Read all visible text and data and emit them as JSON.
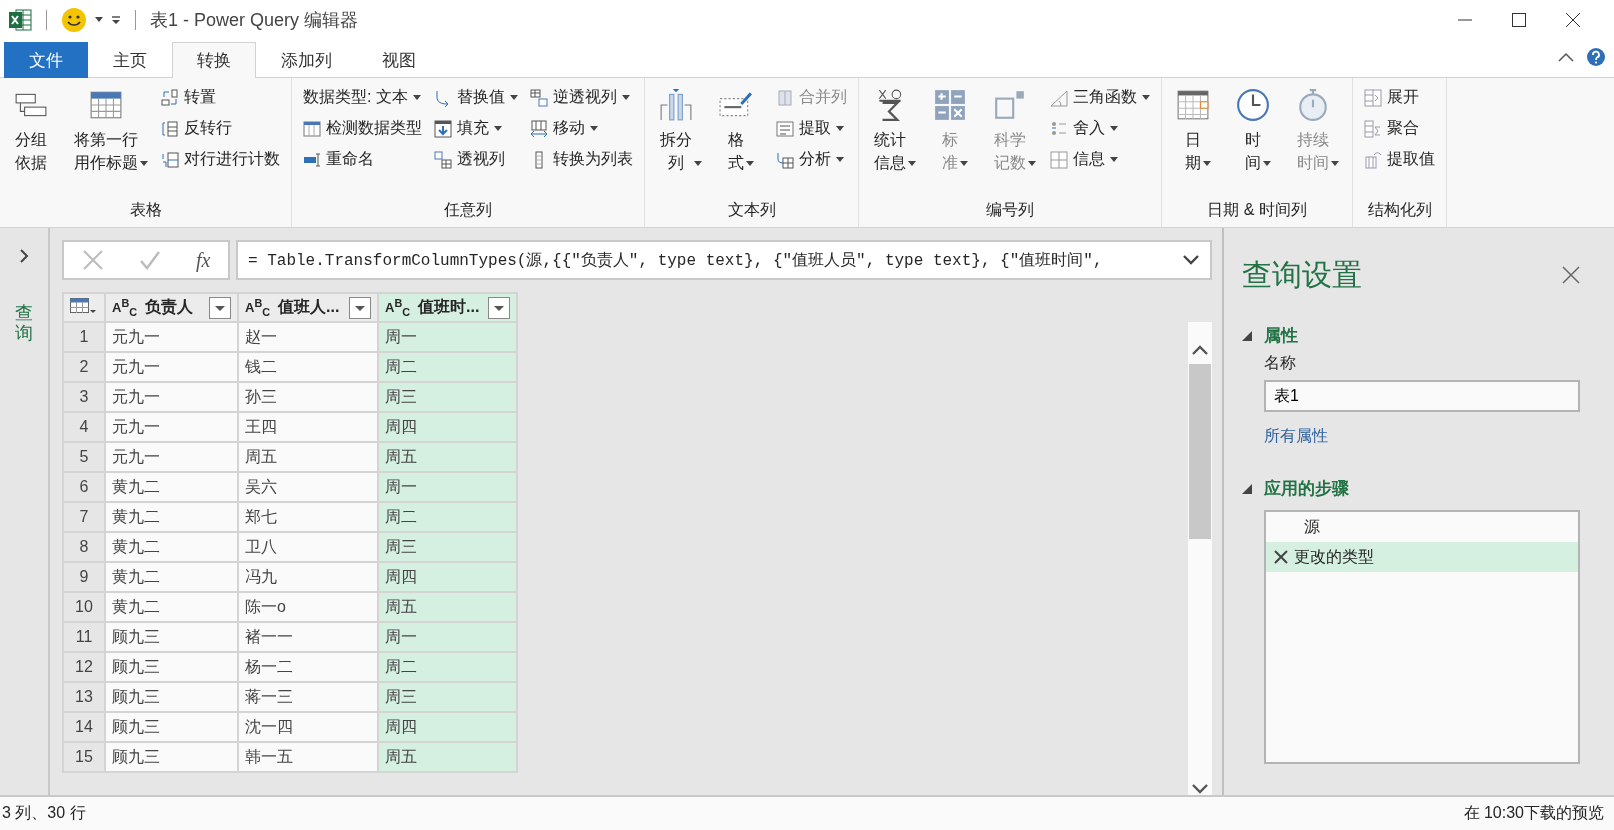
{
  "window": {
    "title": "表1 - Power Query 编辑器"
  },
  "tabs": [
    {
      "label": "文件",
      "kind": "file",
      "selected": false
    },
    {
      "label": "主页",
      "kind": "tab",
      "selected": false
    },
    {
      "label": "转换",
      "kind": "tab",
      "selected": true
    },
    {
      "label": "添加列",
      "kind": "tab",
      "selected": false
    },
    {
      "label": "视图",
      "kind": "tab",
      "selected": false
    }
  ],
  "ribbon": {
    "groups": [
      {
        "label": "表格",
        "columns": [
          {
            "kind": "large",
            "label": "分组依据",
            "dropdown": false,
            "disabled": false
          },
          {
            "kind": "large",
            "label": "将第一行用作标题",
            "dropdown": true,
            "disabled": false
          },
          {
            "kind": "stack",
            "items": [
              {
                "label": "转置",
                "dropdown": false,
                "disabled": false
              },
              {
                "label": "反转行",
                "dropdown": false,
                "disabled": false
              },
              {
                "label": "对行进行计数",
                "dropdown": false,
                "disabled": false
              }
            ]
          }
        ]
      },
      {
        "label": "任意列",
        "columns": [
          {
            "kind": "stack",
            "items": [
              {
                "label": "数据类型: 文本",
                "dropdown": true,
                "disabled": false
              },
              {
                "label": "检测数据类型",
                "dropdown": false,
                "disabled": false
              },
              {
                "label": "重命名",
                "dropdown": false,
                "disabled": false
              }
            ]
          },
          {
            "kind": "stack",
            "items": [
              {
                "label": "替换值",
                "dropdown": true,
                "disabled": false
              },
              {
                "label": "填充",
                "dropdown": true,
                "disabled": false
              },
              {
                "label": "透视列",
                "dropdown": false,
                "disabled": false
              }
            ]
          },
          {
            "kind": "stack",
            "items": [
              {
                "label": "逆透视列",
                "dropdown": true,
                "disabled": false
              },
              {
                "label": "移动",
                "dropdown": true,
                "disabled": false
              },
              {
                "label": "转换为列表",
                "dropdown": false,
                "disabled": false
              }
            ]
          }
        ]
      },
      {
        "label": "文本列",
        "columns": [
          {
            "kind": "large",
            "label": "拆分列",
            "dropdown": true,
            "disabled": false
          },
          {
            "kind": "large",
            "label": "格式",
            "dropdown": true,
            "disabled": false
          },
          {
            "kind": "stack",
            "items": [
              {
                "label": "合并列",
                "dropdown": false,
                "disabled": true
              },
              {
                "label": "提取",
                "dropdown": true,
                "disabled": false
              },
              {
                "label": "分析",
                "dropdown": true,
                "disabled": false
              }
            ]
          }
        ]
      },
      {
        "label": "编号列",
        "columns": [
          {
            "kind": "large",
            "label": "统计信息",
            "dropdown": true,
            "disabled": false
          },
          {
            "kind": "large",
            "label": "标准",
            "dropdown": true,
            "disabled": true
          },
          {
            "kind": "large",
            "label": "科学记数",
            "dropdown": true,
            "disabled": true
          },
          {
            "kind": "stack",
            "items": [
              {
                "label": "三角函数",
                "dropdown": true,
                "disabled": false
              },
              {
                "label": "舍入",
                "dropdown": true,
                "disabled": false
              },
              {
                "label": "信息",
                "dropdown": true,
                "disabled": false
              }
            ]
          }
        ]
      },
      {
        "label": "日期 & 时间列",
        "columns": [
          {
            "kind": "large",
            "label": "日期",
            "dropdown": true,
            "disabled": false
          },
          {
            "kind": "large",
            "label": "时间",
            "dropdown": true,
            "disabled": false
          },
          {
            "kind": "large",
            "label": "持续时间",
            "dropdown": true,
            "disabled": true
          }
        ]
      },
      {
        "label": "结构化列",
        "columns": [
          {
            "kind": "stack",
            "items": [
              {
                "label": "展开",
                "dropdown": false,
                "disabled": false
              },
              {
                "label": "聚合",
                "dropdown": false,
                "disabled": false
              },
              {
                "label": "提取值",
                "dropdown": false,
                "disabled": false
              }
            ]
          }
        ]
      }
    ]
  },
  "queries_pane": {
    "label": "查询"
  },
  "formula_bar": {
    "fx_label": "fx",
    "formula": "= Table.TransformColumnTypes(源,{{\"负责人\", type text}, {\"值班人员\", type text}, {\"值班时间\","
  },
  "table": {
    "columns": [
      {
        "type": "A$^{B}$$_{C}$",
        "name": "负责人",
        "selected": false
      },
      {
        "type": "A$^{B}$$_{C}$",
        "name": "值班人...",
        "selected": false
      },
      {
        "type": "A$^{B}$$_{C}$",
        "name": "值班时...",
        "selected": true
      }
    ],
    "rows": [
      {
        "number": "1",
        "cells": [
          "元九一",
          "赵一",
          "周一"
        ]
      },
      {
        "number": "2",
        "cells": [
          "元九一",
          "钱二",
          "周二"
        ]
      },
      {
        "number": "3",
        "cells": [
          "元九一",
          "孙三",
          "周三"
        ]
      },
      {
        "number": "4",
        "cells": [
          "元九一",
          "王四",
          "周四"
        ]
      },
      {
        "number": "5",
        "cells": [
          "元九一",
          "周五",
          "周五"
        ]
      },
      {
        "number": "6",
        "cells": [
          "黄九二",
          "吴六",
          "周一"
        ]
      },
      {
        "number": "7",
        "cells": [
          "黄九二",
          "郑七",
          "周二"
        ]
      },
      {
        "number": "8",
        "cells": [
          "黄九二",
          "卫八",
          "周三"
        ]
      },
      {
        "number": "9",
        "cells": [
          "黄九二",
          "冯九",
          "周四"
        ]
      },
      {
        "number": "10",
        "cells": [
          "黄九二",
          "陈一o",
          "周五"
        ]
      },
      {
        "number": "11",
        "cells": [
          "顾九三",
          "褚一一",
          "周一"
        ]
      },
      {
        "number": "12",
        "cells": [
          "顾九三",
          "杨一二",
          "周二"
        ]
      },
      {
        "number": "13",
        "cells": [
          "顾九三",
          "蒋一三",
          "周三"
        ]
      },
      {
        "number": "14",
        "cells": [
          "顾九三",
          "沈一四",
          "周四"
        ]
      },
      {
        "number": "15",
        "cells": [
          "顾九三",
          "韩一五",
          "周五"
        ]
      }
    ]
  },
  "query_settings": {
    "title": "查询设置",
    "properties": {
      "heading": "属性",
      "expanded": true,
      "name_label": "名称",
      "name_value": "表1",
      "all_properties_link": "所有属性"
    },
    "applied_steps": {
      "heading": "应用的步骤",
      "expanded": true,
      "steps": [
        {
          "label": "源",
          "selected": false
        },
        {
          "label": "更改的类型",
          "selected": true
        }
      ]
    }
  },
  "status_bar": {
    "left": "3 列、30 行",
    "right": "在 10:30下载的预览"
  }
}
